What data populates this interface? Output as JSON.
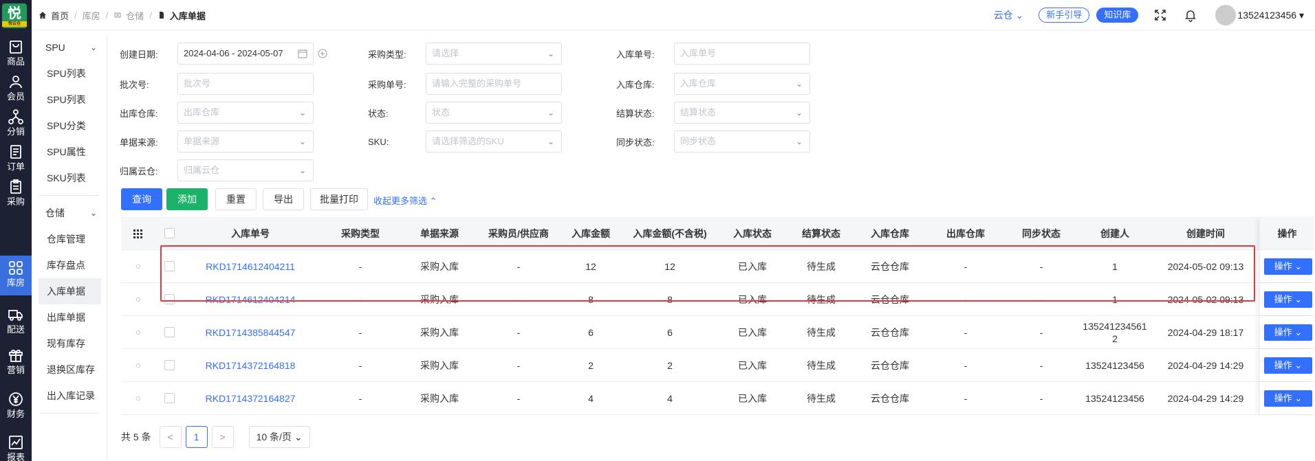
{
  "rail": {
    "logo": "悦",
    "logo_sub": "悦云仓",
    "items": [
      {
        "label": "商品",
        "icon": "bag-icon"
      },
      {
        "label": "会员",
        "icon": "user-icon"
      },
      {
        "label": "分销",
        "icon": "network-icon"
      },
      {
        "label": "订单",
        "icon": "order-icon"
      },
      {
        "label": "采购",
        "icon": "clipboard-icon"
      },
      {
        "label": "库房",
        "icon": "grid-icon"
      },
      {
        "label": "配送",
        "icon": "truck-icon"
      },
      {
        "label": "营销",
        "icon": "gift-icon"
      },
      {
        "label": "财务",
        "icon": "yen-icon"
      },
      {
        "label": "报表",
        "icon": "chart-icon"
      }
    ],
    "active": "库房"
  },
  "submenu": {
    "group1": "SPU",
    "group1_items": [
      "SPU列表",
      "SPU列表",
      "SPU分类",
      "SPU属性",
      "SKU列表"
    ],
    "group2": "仓储",
    "group2_items": [
      "仓库管理",
      "库存盘点",
      "入库单据",
      "出库单据",
      "现有库存",
      "退换区库存",
      "出入库记录"
    ],
    "active": "入库单据"
  },
  "topbar": {
    "crumbs": [
      "首页",
      "库房",
      "仓储",
      "入库单据"
    ],
    "yuncang": "云仓",
    "guide": "新手引导",
    "knowledge": "知识库",
    "username": "13524123456"
  },
  "filters": {
    "create_date_label": "创建日期:",
    "create_date_value": "2024-04-06 - 2024-05-07",
    "batch_label": "批次号:",
    "batch_ph": "批次号",
    "out_wh_label": "出库仓库:",
    "out_wh_ph": "出库仓库",
    "source_label": "单据来源:",
    "source_ph": "单据来源",
    "cloud_label": "归属云仓:",
    "cloud_ph": "归属云仓",
    "ptype_label": "采购类型:",
    "ptype_ph": "请选择",
    "pno_label": "采购单号:",
    "pno_ph": "请输入完整的采购单号",
    "status_label": "状态:",
    "status_ph": "状态",
    "sku_label": "SKU:",
    "sku_ph": "请选择筛选的SKU",
    "inno_label": "入库单号:",
    "inno_ph": "入库单号",
    "in_wh_label": "入库仓库:",
    "in_wh_ph": "入库仓库",
    "settle_label": "结算状态:",
    "settle_ph": "结算状态",
    "sync_label": "同步状态:",
    "sync_ph": "同步状态"
  },
  "actions": {
    "query": "查询",
    "add": "添加",
    "reset": "重置",
    "export": "导出",
    "batch_print": "批量打印",
    "collapse": "收起更多筛选"
  },
  "table": {
    "headers": [
      "入库单号",
      "采购类型",
      "单据来源",
      "采购员/供应商",
      "入库金额",
      "入库金额(不含税)",
      "入库状态",
      "结算状态",
      "入库仓库",
      "出库仓库",
      "同步状态",
      "创建人",
      "创建时间",
      "操作"
    ],
    "rows": [
      {
        "no": "RKD1714612404211",
        "ptype": "-",
        "source": "采购入库",
        "buyer": "-",
        "amount": "12",
        "amount_nt": "12",
        "in_status": "已入库",
        "settle": "待生成",
        "in_wh": "云仓仓库",
        "out_wh": "-",
        "sync": "-",
        "creator": "1",
        "creator2": "",
        "time": "2024-05-02 09:13",
        "op": "操作"
      },
      {
        "no": "RKD1714612404214",
        "ptype": "-",
        "source": "采购入库",
        "buyer": "-",
        "amount": "8",
        "amount_nt": "8",
        "in_status": "已入库",
        "settle": "待生成",
        "in_wh": "云仓仓库",
        "out_wh": "-",
        "sync": "-",
        "creator": "1",
        "creator2": "",
        "time": "2024-05-02 09:13",
        "op": "操作"
      },
      {
        "no": "RKD1714385844547",
        "ptype": "-",
        "source": "采购入库",
        "buyer": "-",
        "amount": "6",
        "amount_nt": "6",
        "in_status": "已入库",
        "settle": "待生成",
        "in_wh": "云仓仓库",
        "out_wh": "-",
        "sync": "-",
        "creator": "135241234561",
        "creator2": "2",
        "time": "2024-04-29 18:17",
        "op": "操作"
      },
      {
        "no": "RKD1714372164818",
        "ptype": "-",
        "source": "采购入库",
        "buyer": "-",
        "amount": "2",
        "amount_nt": "2",
        "in_status": "已入库",
        "settle": "待生成",
        "in_wh": "云仓仓库",
        "out_wh": "-",
        "sync": "-",
        "creator": "13524123456",
        "creator2": "",
        "time": "2024-04-29 14:29",
        "op": "操作"
      },
      {
        "no": "RKD1714372164827",
        "ptype": "-",
        "source": "采购入库",
        "buyer": "-",
        "amount": "4",
        "amount_nt": "4",
        "in_status": "已入库",
        "settle": "待生成",
        "in_wh": "云仓仓库",
        "out_wh": "-",
        "sync": "-",
        "creator": "13524123456",
        "creator2": "",
        "time": "2024-04-29 14:29",
        "op": "操作"
      }
    ]
  },
  "pager": {
    "total": "共 5 条",
    "page": "1",
    "prev": "<",
    "next": ">",
    "size": "10 条/页"
  },
  "colors": {
    "accent": "#3370ff",
    "green": "#1bb36a",
    "rail_bg": "#1c2233",
    "highlight": "#e53935"
  }
}
